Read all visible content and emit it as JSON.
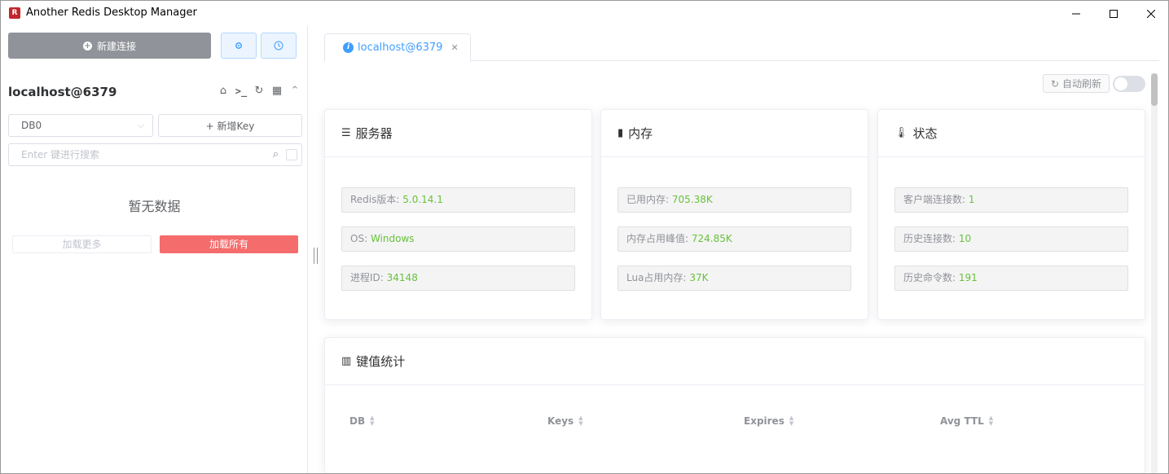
{
  "window": {
    "title": "Another Redis Desktop Manager",
    "controls": {
      "minimize": "—",
      "maximize": "☐",
      "close": "✕"
    }
  },
  "sidebar": {
    "new_connection_label": "新建连接",
    "connection_name": "localhost@6379",
    "db_select": "DB0",
    "new_key_label": "+ 新增Key",
    "search_placeholder": "Enter 键进行搜索",
    "empty_text": "暂无数据",
    "load_more_label": "加载更多",
    "load_all_label": "加载所有"
  },
  "tabs": [
    {
      "label": "localhost@6379",
      "active": true
    }
  ],
  "toolbar": {
    "auto_refresh_label": "自动刷新",
    "auto_refresh_on": false
  },
  "server": {
    "title": "服务器",
    "items": [
      {
        "label": "Redis版本:",
        "value": "5.0.14.1"
      },
      {
        "label": "OS:",
        "value": "Windows"
      },
      {
        "label": "进程ID:",
        "value": "34148"
      }
    ]
  },
  "memory": {
    "title": "内存",
    "items": [
      {
        "label": "已用内存:",
        "value": "705.38K"
      },
      {
        "label": "内存占用峰值:",
        "value": "724.85K"
      },
      {
        "label": "Lua占用内存:",
        "value": "37K"
      }
    ]
  },
  "status": {
    "title": "状态",
    "items": [
      {
        "label": "客户端连接数:",
        "value": "1"
      },
      {
        "label": "历史连接数:",
        "value": "10"
      },
      {
        "label": "历史命令数:",
        "value": "191"
      }
    ]
  },
  "keyspace": {
    "title": "键值统计",
    "columns": [
      "DB",
      "Keys",
      "Expires",
      "Avg TTL"
    ]
  },
  "colors": {
    "accent": "#409eff",
    "danger": "#f56c6c",
    "value_green": "#67c23a",
    "muted": "#909399"
  }
}
